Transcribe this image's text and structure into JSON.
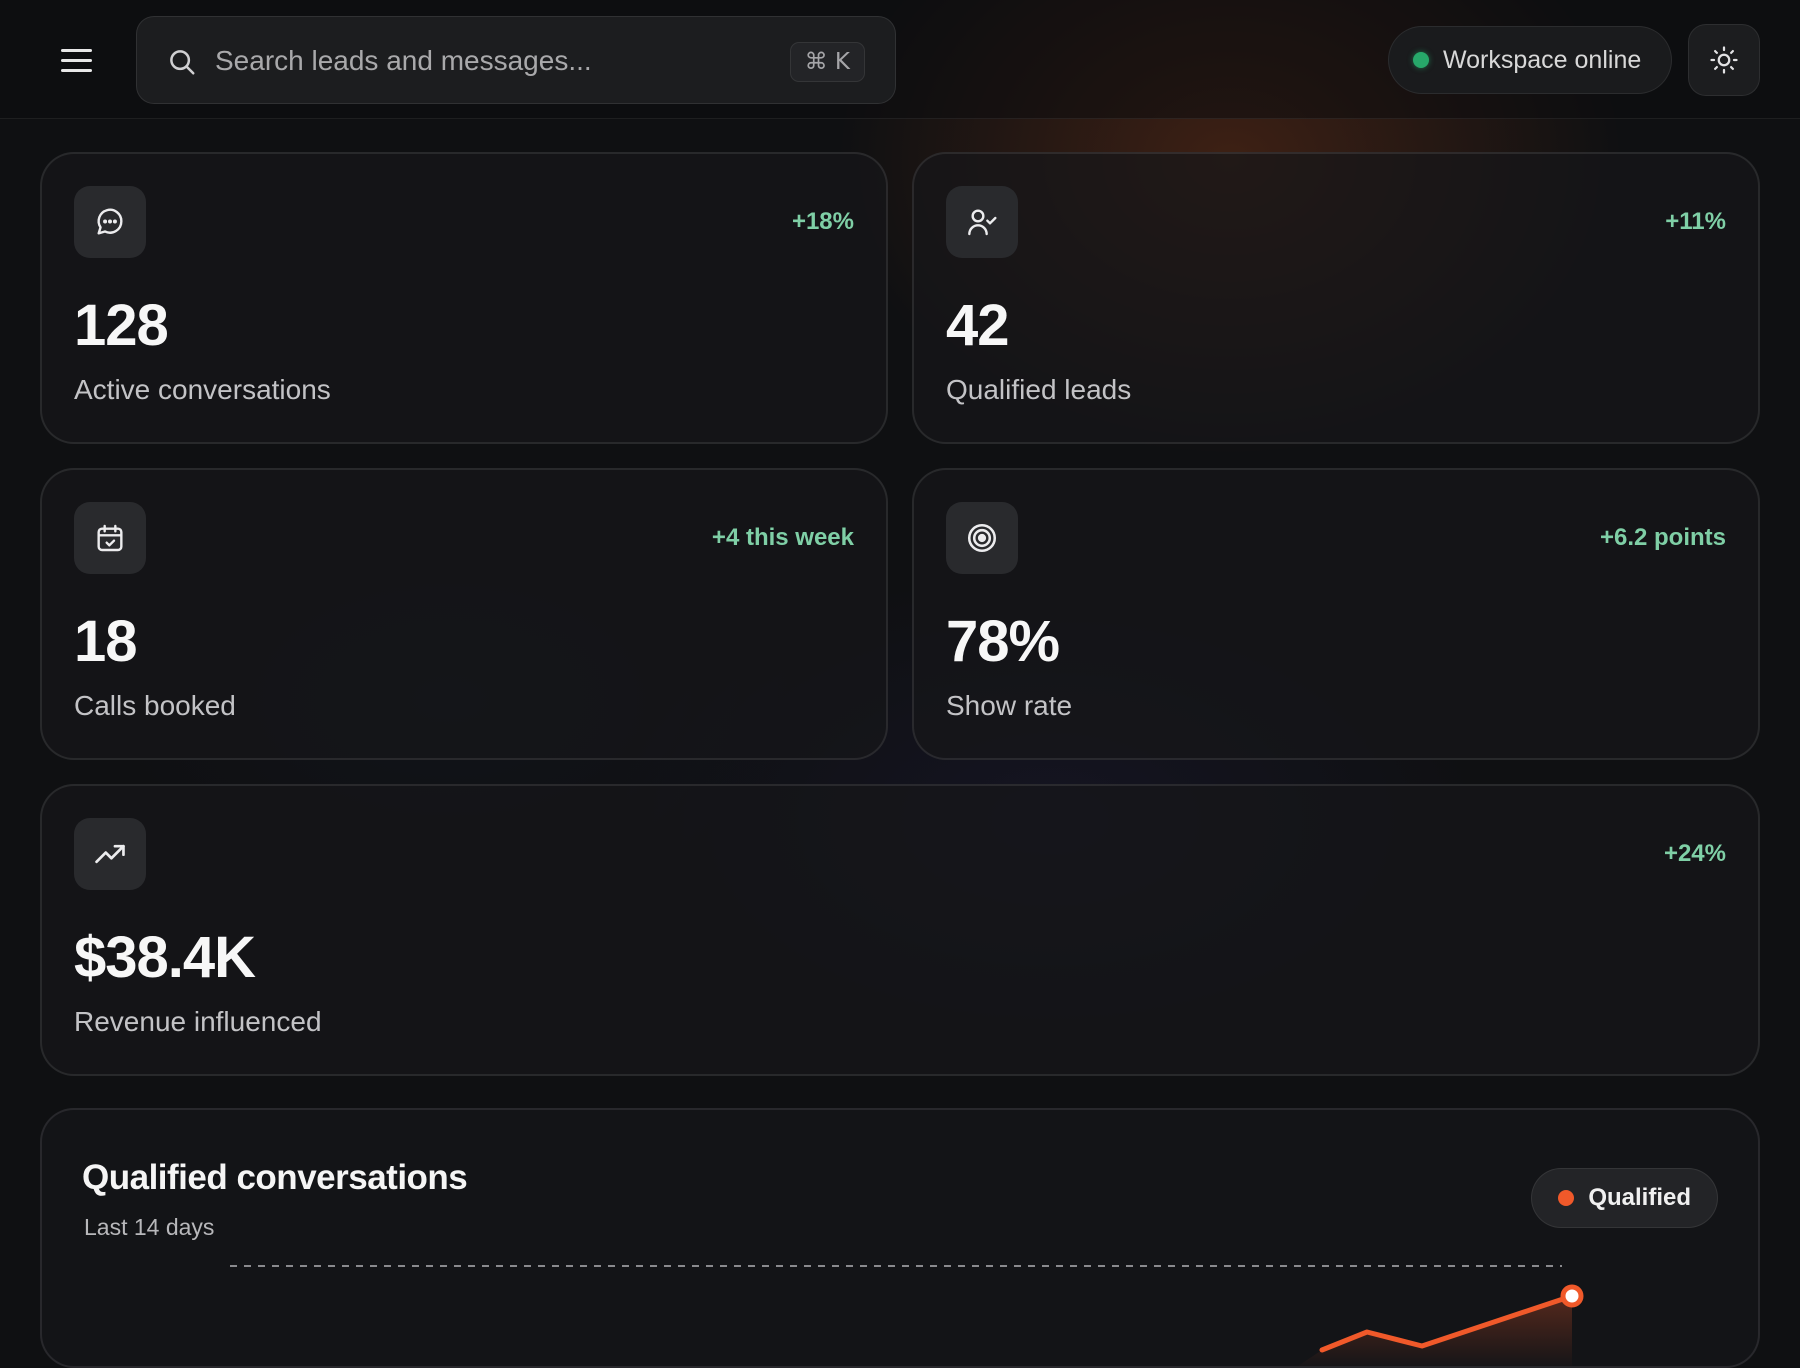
{
  "header": {
    "search": {
      "placeholder": "Search leads and messages...",
      "shortcut": "⌘ K"
    },
    "status": {
      "label": "Workspace online",
      "color": "#27a86a"
    }
  },
  "stats": [
    {
      "icon": "message-circle-icon",
      "delta": "+18%",
      "value": "128",
      "label": "Active conversations"
    },
    {
      "icon": "user-check-icon",
      "delta": "+11%",
      "value": "42",
      "label": "Qualified leads"
    },
    {
      "icon": "calendar-check-icon",
      "delta": "+4 this week",
      "value": "18",
      "label": "Calls booked"
    },
    {
      "icon": "target-icon",
      "delta": "+6.2 points",
      "value": "78%",
      "label": "Show rate"
    },
    {
      "icon": "trending-up-icon",
      "delta": "+24%",
      "value": "$38.4K",
      "label": "Revenue influenced"
    }
  ],
  "colors": {
    "accent": "#f0592a",
    "positive": "#7fcfa6"
  },
  "qualified_chart": {
    "title": "Qualified conversations",
    "subtitle": "Last 14 days",
    "legend": "Qualified"
  }
}
